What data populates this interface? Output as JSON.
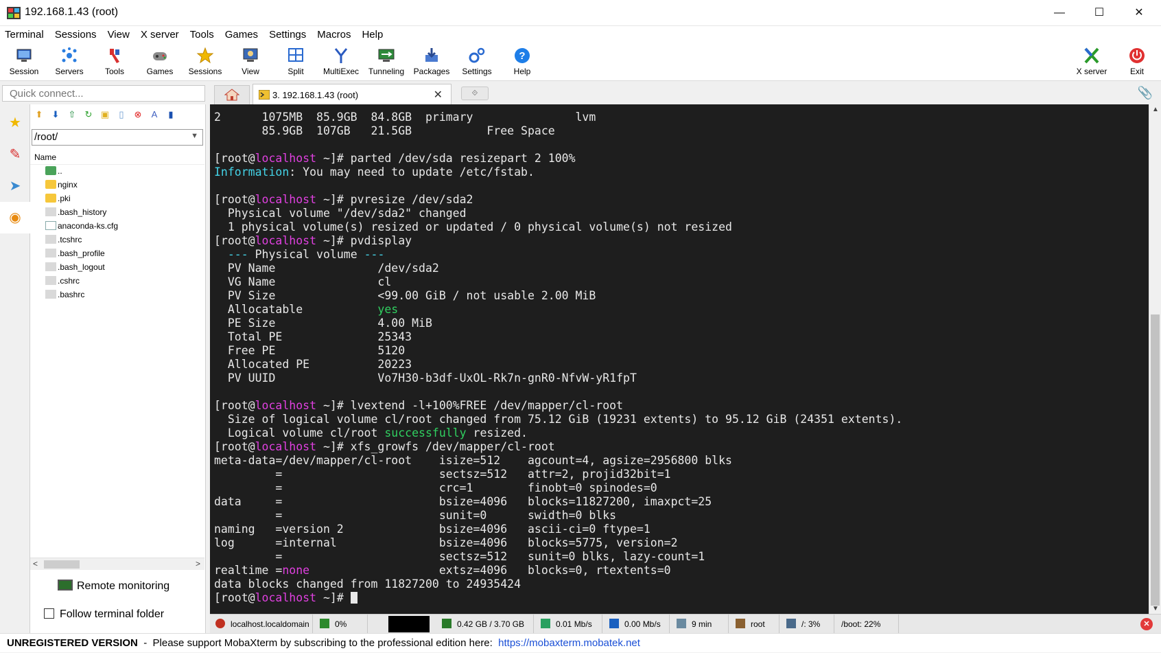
{
  "window": {
    "title": "192.168.1.43 (root)",
    "minimize": "—",
    "maximize": "☐",
    "close": "✕"
  },
  "menu": [
    "Terminal",
    "Sessions",
    "View",
    "X server",
    "Tools",
    "Games",
    "Settings",
    "Macros",
    "Help"
  ],
  "toolbar": {
    "left": [
      {
        "label": "Session",
        "icon": "session-icon",
        "glyph": "🖥"
      },
      {
        "label": "Servers",
        "icon": "servers-icon",
        "glyph": "✳"
      },
      {
        "label": "Tools",
        "icon": "tools-icon",
        "glyph": "🔧"
      },
      {
        "label": "Games",
        "icon": "games-icon",
        "glyph": "🎮"
      },
      {
        "label": "Sessions",
        "icon": "star-icon",
        "glyph": "★"
      },
      {
        "label": "View",
        "icon": "view-icon",
        "glyph": "👁"
      },
      {
        "label": "Split",
        "icon": "split-icon",
        "glyph": "▦"
      },
      {
        "label": "MultiExec",
        "icon": "multiexec-icon",
        "glyph": "Y"
      },
      {
        "label": "Tunneling",
        "icon": "tunneling-icon",
        "glyph": "⇄"
      },
      {
        "label": "Packages",
        "icon": "packages-icon",
        "glyph": "⬇"
      },
      {
        "label": "Settings",
        "icon": "settings-icon",
        "glyph": "⚙"
      },
      {
        "label": "Help",
        "icon": "help-icon",
        "glyph": "?"
      }
    ],
    "xserver_label": "X server",
    "exit_label": "Exit"
  },
  "quick_connect_placeholder": "Quick connect...",
  "session_tab": {
    "label": "3. 192.168.1.43 (root)",
    "close": "✕"
  },
  "filepanel": {
    "path": "/root/",
    "column_name": "Name",
    "files": [
      {
        "name": "..",
        "type": "up"
      },
      {
        "name": "nginx",
        "type": "folder"
      },
      {
        "name": ".pki",
        "type": "folder"
      },
      {
        "name": ".bash_history",
        "type": "doc"
      },
      {
        "name": "anaconda-ks.cfg",
        "type": "cfg"
      },
      {
        "name": ".tcshrc",
        "type": "doc"
      },
      {
        "name": ".bash_profile",
        "type": "doc"
      },
      {
        "name": ".bash_logout",
        "type": "doc"
      },
      {
        "name": ".cshrc",
        "type": "doc"
      },
      {
        "name": ".bashrc",
        "type": "doc"
      }
    ],
    "remote_monitoring": "Remote monitoring",
    "follow_terminal_folder": "Follow terminal folder"
  },
  "terminal": {
    "lines": [
      [
        [
          "2      1075MB  85.9GB  84.8GB  primary               lvm",
          ""
        ]
      ],
      [
        [
          "       85.9GB  107GB   21.5GB           Free Space",
          ""
        ]
      ],
      [
        [
          "",
          ""
        ]
      ],
      [
        [
          "[root@",
          ""
        ],
        [
          "localhost",
          "magenta"
        ],
        [
          " ~]# parted /dev/sda resizepart 2 100%",
          ""
        ]
      ],
      [
        [
          "Information",
          "cyan"
        ],
        [
          ": You may need to update /etc/fstab.",
          ""
        ]
      ],
      [
        [
          "",
          ""
        ]
      ],
      [
        [
          "[root@",
          ""
        ],
        [
          "localhost",
          "magenta"
        ],
        [
          " ~]# pvresize /dev/sda2",
          ""
        ]
      ],
      [
        [
          "  Physical volume \"/dev/sda2\" changed",
          ""
        ]
      ],
      [
        [
          "  1 physical volume(s) resized or updated / 0 physical volume(s) not resized",
          ""
        ]
      ],
      [
        [
          "[root@",
          ""
        ],
        [
          "localhost",
          "magenta"
        ],
        [
          " ~]# pvdisplay",
          ""
        ]
      ],
      [
        [
          "  ",
          ""
        ],
        [
          "--- ",
          "cyan"
        ],
        [
          "Physical volume",
          ""
        ],
        [
          " ---",
          "cyan"
        ]
      ],
      [
        [
          "  PV Name               /dev/sda2",
          ""
        ]
      ],
      [
        [
          "  VG Name               cl",
          ""
        ]
      ],
      [
        [
          "  PV Size               <99.00 GiB / not usable 2.00 MiB",
          ""
        ]
      ],
      [
        [
          "  Allocatable           ",
          ""
        ],
        [
          "yes",
          "green"
        ]
      ],
      [
        [
          "  PE Size               4.00 MiB",
          ""
        ]
      ],
      [
        [
          "  Total PE              25343",
          ""
        ]
      ],
      [
        [
          "  Free PE               5120",
          ""
        ]
      ],
      [
        [
          "  Allocated PE          20223",
          ""
        ]
      ],
      [
        [
          "  PV UUID               Vo7H30-b3df-UxOL-Rk7n-gnR0-NfvW-yR1fpT",
          ""
        ]
      ],
      [
        [
          "",
          ""
        ]
      ],
      [
        [
          "[root@",
          ""
        ],
        [
          "localhost",
          "magenta"
        ],
        [
          " ~]# lvextend -l+100%FREE /dev/mapper/cl-root",
          ""
        ]
      ],
      [
        [
          "  Size of logical volume cl/root changed from 75.12 GiB (19231 extents) to 95.12 GiB (24351 extents).",
          ""
        ]
      ],
      [
        [
          "  Logical volume cl/root ",
          ""
        ],
        [
          "successfully",
          "green"
        ],
        [
          " resized.",
          ""
        ]
      ],
      [
        [
          "[root@",
          ""
        ],
        [
          "localhost",
          "magenta"
        ],
        [
          " ~]# xfs_growfs /dev/mapper/cl-root",
          ""
        ]
      ],
      [
        [
          "meta-data=/dev/mapper/cl-root    isize=512    agcount=4, agsize=2956800 blks",
          ""
        ]
      ],
      [
        [
          "         =                       sectsz=512   attr=2, projid32bit=1",
          ""
        ]
      ],
      [
        [
          "         =                       crc=1        finobt=0 spinodes=0",
          ""
        ]
      ],
      [
        [
          "data     =                       bsize=4096   blocks=11827200, imaxpct=25",
          ""
        ]
      ],
      [
        [
          "         =                       sunit=0      swidth=0 blks",
          ""
        ]
      ],
      [
        [
          "naming   =version 2              bsize=4096   ascii-ci=0 ftype=1",
          ""
        ]
      ],
      [
        [
          "log      =internal               bsize=4096   blocks=5775, version=2",
          ""
        ]
      ],
      [
        [
          "         =                       sectsz=512   sunit=0 blks, lazy-count=1",
          ""
        ]
      ],
      [
        [
          "realtime =",
          ""
        ],
        [
          "none",
          "magenta"
        ],
        [
          "                   extsz=4096   blocks=0, rtextents=0",
          ""
        ]
      ],
      [
        [
          "data blocks changed from 11827200 to 24935424",
          ""
        ]
      ],
      [
        [
          "[root@",
          ""
        ],
        [
          "localhost",
          "magenta"
        ],
        [
          " ~]# ",
          ""
        ],
        [
          "CURSOR",
          "cursor"
        ]
      ]
    ]
  },
  "statusbar": {
    "host": "localhost.localdomain",
    "cpu": "0%",
    "memory": "0.42 GB / 3.70 GB",
    "upload": "0.01 Mb/s",
    "download": "0.00 Mb/s",
    "uptime": "9 min",
    "user": "root",
    "disk_root": "/: 3%",
    "disk_boot": "/boot: 22%"
  },
  "bottom": {
    "unregistered": "UNREGISTERED VERSION",
    "message": "  -  Please support MobaXterm by subscribing to the professional edition here:  ",
    "link": "https://mobaxterm.mobatek.net"
  },
  "colors": {
    "magenta": "#e040e0",
    "cyan": "#44d4e8",
    "green": "#30d060",
    "terminal_bg": "#1e1e1e"
  }
}
